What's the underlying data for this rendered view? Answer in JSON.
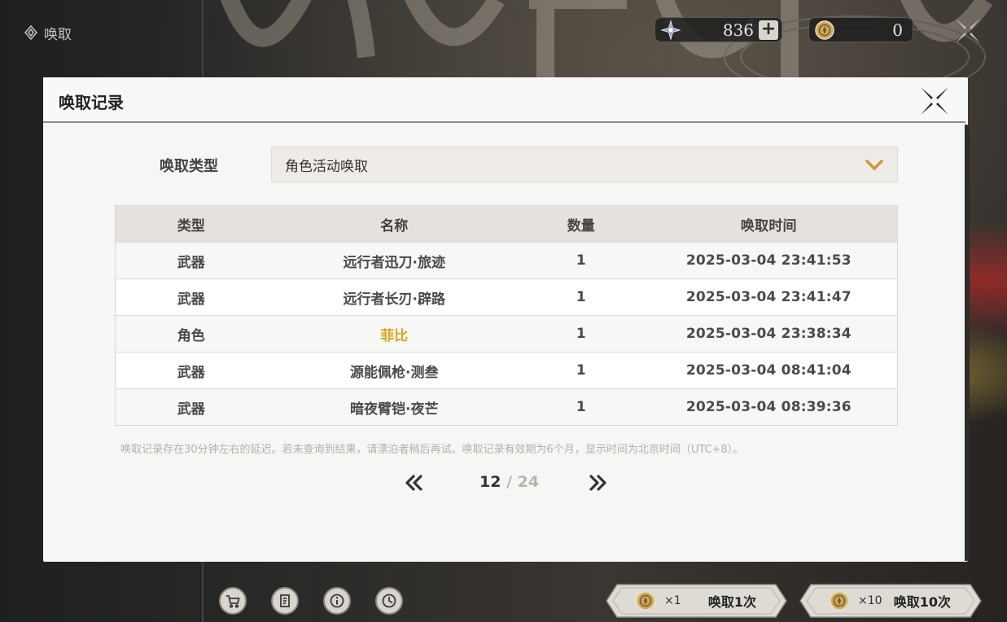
{
  "page": {
    "title": "唤取"
  },
  "currencies": [
    {
      "icon": "star-crystal-icon",
      "value": "836"
    },
    {
      "icon": "gold-coin-icon",
      "value": "0"
    }
  ],
  "dialog": {
    "title": "唤取记录",
    "type_label": "唤取类型",
    "type_selected": "角色活动唤取",
    "table": {
      "headers": [
        "类型",
        "名称",
        "数量",
        "唤取时间"
      ],
      "rows": [
        {
          "type": "武器",
          "name": "远行者迅刀·旅迹",
          "qty": "1",
          "time": "2025-03-04 23:41:53",
          "highlight": false
        },
        {
          "type": "武器",
          "name": "远行者长刃·辟路",
          "qty": "1",
          "time": "2025-03-04 23:41:47",
          "highlight": false
        },
        {
          "type": "角色",
          "name": "菲比",
          "qty": "1",
          "time": "2025-03-04 23:38:34",
          "highlight": true
        },
        {
          "type": "武器",
          "name": "源能佩枪·测叁",
          "qty": "1",
          "time": "2025-03-04 08:41:04",
          "highlight": false
        },
        {
          "type": "武器",
          "name": "暗夜臂铠·夜芒",
          "qty": "1",
          "time": "2025-03-04 08:39:36",
          "highlight": false
        }
      ]
    },
    "note": "唤取记录存在30分钟左右的延迟。若未查询到结果，请漂泊者稍后再试。唤取记录有效期为6个月，显示时间为北京时间（UTC+8）。",
    "pager": {
      "current": "12",
      "separator": " / ",
      "total": "24"
    }
  },
  "colors": {
    "highlight": "#d9a521",
    "dialog_bg": "#f6f6f4",
    "header_row": "#e4e1de"
  },
  "bottom_bar": {
    "icon_buttons": [
      "cart-icon",
      "document-icon",
      "info-icon",
      "clock-icon"
    ],
    "draw_buttons": [
      {
        "mult": "×1",
        "label": "唤取1次"
      },
      {
        "mult": "×10",
        "label": "唤取10次"
      }
    ]
  }
}
